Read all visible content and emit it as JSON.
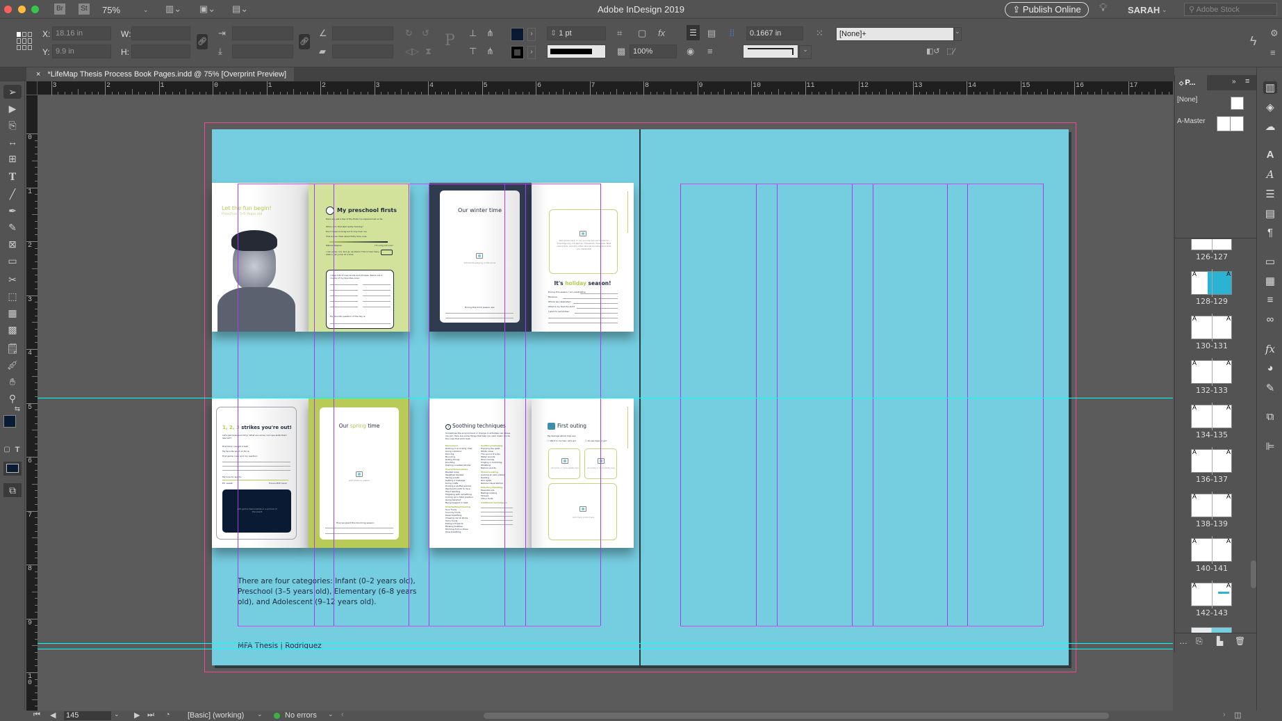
{
  "app": {
    "title": "Adobe InDesign 2019",
    "zoom": "75%",
    "bridge": "Br",
    "stock": "St",
    "publish": "Publish Online",
    "user": "SARAH",
    "search_placeholder": "Adobe Stock"
  },
  "control": {
    "x_label": "X:",
    "x_value": "18.16 in",
    "y_label": "Y:",
    "y_value": "9.9 in",
    "w_label": "W:",
    "h_label": "H:",
    "stroke_weight": "1 pt",
    "opacity": "100%",
    "gap": "0.1667 in",
    "object_style": "[None]+",
    "fill_color": "#0b1a33",
    "stroke_color": "#000000"
  },
  "document_tab": {
    "title": "*LifeMap Thesis Process Book Pages.indd @ 75% [Overprint Preview]"
  },
  "rulers": {
    "horizontal": [
      "3",
      "2",
      "1",
      "0",
      "1",
      "2",
      "3",
      "4",
      "5",
      "6",
      "7",
      "8",
      "9",
      "10",
      "11",
      "12",
      "13",
      "14",
      "15",
      "16",
      "17"
    ],
    "vertical": [
      "0",
      "1",
      "2",
      "3",
      "4",
      "5",
      "6",
      "7",
      "8",
      "9",
      "1 0"
    ]
  },
  "colors": {
    "page_bg": "#75cde0",
    "guide": "#a23cf5",
    "bleed": "#f0488f",
    "ruler_guide": "#00ffff",
    "lime": "#b5c955",
    "navy": "#1d2a40"
  },
  "spread": {
    "body_text": "There are four categories: Infant (0–2 years old), Preschool (3–5 years old), Elementary (6–8 years old), and Adolescent (9–12 years old).",
    "footer": "MFA Thesis | Rodriguez",
    "mock1": {
      "left_title": "Let the fun begin!",
      "left_sub": "Preschool 3–5 Years old",
      "right_title": "My preschool firsts",
      "intro": "Here are just a few of the firsts I've experienced so far.",
      "prompts": [
        "When did I first start potty training?",
        "Don't mean to brag but it only took me",
        "This is how I feel about Potty time now:"
      ],
      "scale_left": "Mature diapers.",
      "scale_right": "I'm a big kid now!",
      "stairs": "I can jump, run, and go up stairs! This is how many stairs I can jump at a time:",
      "words": "I have lots of new words and phrases. Below are a couple of my favorites ones:",
      "question": "My favorite question of the day is:"
    },
    "mock2": {
      "left_title": "Our winter time",
      "left_caption": "Add photo playing in the snow",
      "left_prompt": "During this brisk season, we:",
      "photo_caption": "Add photo here, it can include but not limited to Thanksgiving, Christmas, Hanukkah, Kwanzaa, New Year's Eve, and any other special bonding time that you celebrate!",
      "title_a": "It's ",
      "title_b": "holiday",
      "title_c": " season!",
      "prompts": [
        "During this season I am celebrating",
        "Because",
        "Where we celebrated:",
        "What is my favorite dish?",
        "I want to remember:"
      ]
    },
    "mock3": {
      "title_a": "1, 2, 3",
      "title_b": " strikes you're out!",
      "intro": "Let's get down and dirty! What are some cool new skills that I learned?",
      "prompts": [
        "First time I caught a ball:",
        "My favorite sport so far is:",
        "First game I saw and my reaction:"
      ],
      "love": "My love for sports:",
      "scale_left": "Eh, sweat.",
      "scale_right": "Future MVP here!",
      "memo": "Add game memorabilia or a picture of the event",
      "right_a": "Our ",
      "right_b": "spring",
      "right_c": " time",
      "right_caption": "Add photo in nature",
      "right_prompt": "How we spent this blooming season:"
    },
    "mock4": {
      "title": "Soothing techniques",
      "intro": "Sometimes the environment or change in activities can stress me out. Here are some things that help me calm down. Circle the ones that work best.",
      "col1": [
        {
          "head": "Movement",
          "items": [
            "Rocking in a rocking chair",
            "Going outdoors",
            "Dancing",
            "Bouncing",
            "Rolling things",
            "Doodling",
            "Pushing a walker/stroller"
          ]
        },
        {
          "head": "Touch/Temperature",
          "items": [
            "Blanket wrap",
            "Weighted blanket",
            "Taking a bath",
            "Getting a massage",
            "Doing crafts",
            "Holding a stuffed animal",
            "Warm/cold cloth to face",
            "Hand washing",
            "Fidgeting with something",
            "Curling up in fetal position",
            "Going barefoot",
            "Being hugged or held"
          ]
        },
        {
          "head": "Oral/Tasting/Chewing",
          "items": [
            "Sour foods",
            "Crunchy foods",
            "Deep breathing",
            "Chewing carrot sticks",
            "Spicy foods",
            "Eating a Popsicle",
            "Blowing bubbles",
            "Drinking from a straw",
            "Slow breathing"
          ]
        }
      ],
      "col2": [
        {
          "head": "Auditory/Listening",
          "items": [
            "Enjoying the quiet",
            "White noise",
            "The sound of a fan",
            "Water sounds",
            "Wind chimes",
            "Singing or humming",
            "Whistling",
            "Nature sounds"
          ]
        },
        {
          "head": "Vision/Looking",
          "items": [
            "Looking at calm videos",
            "Reading",
            "Dim lights",
            "Reduce visual stimuli"
          ]
        },
        {
          "head": "Olfactory/Smelling",
          "items": [
            "Essential oils",
            "Baking/cooking",
            "Flowers",
            "Citrus fruits"
          ]
        },
        {
          "head": "Additional techniques:",
          "items": []
        }
      ],
      "right_title": "First outing",
      "feelings": "My feelings about trips are:",
      "opt1": "Wind in my hair, let's go!",
      "opt2": "Do we have to go?",
      "small_caption": "Add photo or memorability here",
      "main_caption": "Add main photo here"
    }
  },
  "pages_panel": {
    "tab": "P...",
    "none": "[None]",
    "master": "A-Master",
    "spreads": [
      "126-127",
      "128-129",
      "130-131",
      "132-133",
      "134-135",
      "136-137",
      "138-139",
      "140-141",
      "142-143"
    ]
  },
  "status": {
    "page": "145",
    "preflight_profile": "[Basic] (working)",
    "errors": "No errors",
    "status_color": "#3cb043"
  }
}
